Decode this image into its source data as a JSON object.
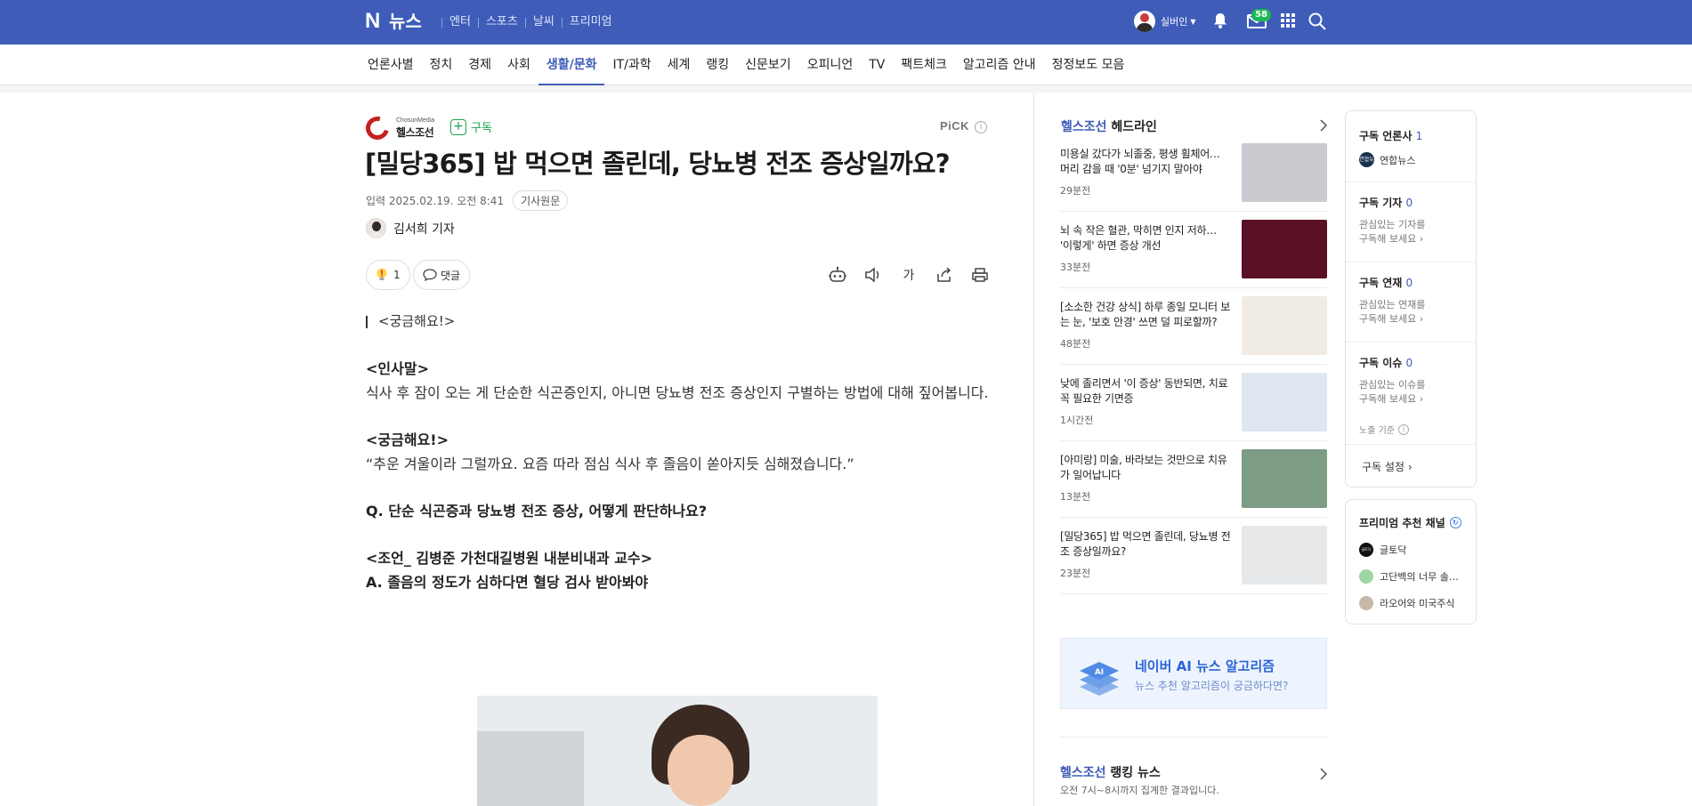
{
  "topbar": {
    "logo_letter": "N",
    "logo_text": "뉴스",
    "nav": [
      "엔터",
      "스포츠",
      "날씨",
      "프리미엄"
    ],
    "user_name": "실버인",
    "mail_count": "58"
  },
  "categories": [
    "언론사별",
    "정치",
    "경제",
    "사회",
    "생활/문화",
    "IT/과학",
    "세계",
    "랭킹",
    "신문보기",
    "오피니언",
    "TV",
    "팩트체크",
    "알고리즘 안내",
    "정정보도 모음"
  ],
  "active_category": "생활/문화",
  "article": {
    "press_small": "ChosunMedia",
    "press_name": "헬스조선",
    "subscribe_label": "구독",
    "pick_label": "PiCK",
    "pick_info": "i",
    "title": "[밀당365] 밥 먹으면 졸린데, 당뇨병 전조 증상일까요?",
    "date": "입력 2025.02.19. 오전 8:41",
    "original_label": "기사원문",
    "reporter": "김서희 기자",
    "reaction_count": "1",
    "comment_label": "댓글",
    "font_size_label": "가",
    "body": {
      "quote_head": "<궁금해요!>",
      "greeting_head": "<인사말>",
      "greeting_text": "식사 후 잠이 오는 게 단순한 식곤증인지, 아니면 당뇨병 전조 증상인지 구별하는 방법에 대해 짚어봅니다.",
      "question_head": "<궁금해요!>",
      "question_text": "“추운 겨울이라 그럴까요. 요즘 따라 점심 식사 후 졸음이 쏟아지듯 심해졌습니다.”",
      "q_line": "Q. 단순 식곤증과 당뇨병 전조 증상, 어떻게 판단하나요?",
      "advice_head": "<조언_ 김병준 가천대길병원 내분비내과 교수>",
      "a_line": "A. 졸음의 정도가 심하다면 혈당 검사 받아봐야"
    }
  },
  "headline": {
    "brand": "헬스조선",
    "label": "헤드라인",
    "items": [
      {
        "title": "미용실 갔다가 뇌졸중, 평생 휠체어… 머리 감을 때 '0분' 넘기지 말아야",
        "time": "29분전",
        "color": "#c9cbd0"
      },
      {
        "title": "뇌 속 작은 혈관, 막히면 인지 저하… '이렇게' 하면 증상 개선",
        "time": "33분전",
        "color": "#5a1024"
      },
      {
        "title": "[소소한 건강 상식] 하루 종일 모니터 보는 눈, '보호 안경' 쓰면 덜 피로할까?",
        "time": "48분전",
        "color": "#f0ece4"
      },
      {
        "title": "낮에 졸리면서 '이 증상' 동반되면, 치료 꼭 필요한 기면증",
        "time": "1시간전",
        "color": "#dfe6f1"
      },
      {
        "title": "[아미랑] 미술, 바라보는 것만으로 치유가 일어납니다",
        "time": "13분전",
        "color": "#7d9c86"
      },
      {
        "title": "[밀당365] 밥 먹으면 졸린데, 당뇨병 전조 증상일까요?",
        "time": "23분전",
        "color": "#e6e8ea"
      }
    ]
  },
  "ai_banner": {
    "title": "네이버 AI 뉴스 알고리즘",
    "subtitle": "뉴스 추천 알고리즘이 궁금하다면?",
    "icon_text": "AI"
  },
  "ranking": {
    "brand": "헬스조선",
    "label": "랭킹 뉴스",
    "subtitle": "오전 7시~8시까지 집계한 결과입니다."
  },
  "subscriptions": {
    "press": {
      "label": "구독 언론사",
      "count": "1",
      "item": "연합뉴스",
      "item_logo": "연합뉴스"
    },
    "reporter": {
      "label": "구독 기자",
      "count": "0",
      "desc1": "관심있는 기자를",
      "desc2": "구독해 보세요"
    },
    "series": {
      "label": "구독 연재",
      "count": "0",
      "desc1": "관심있는 연재를",
      "desc2": "구독해 보세요"
    },
    "issue": {
      "label": "구독 이슈",
      "count": "0",
      "desc1": "관심있는 이슈를",
      "desc2": "구독해 보세요"
    },
    "expose_label": "노출 기준",
    "expose_info": "i",
    "settings_label": "구독 설정"
  },
  "premium": {
    "title": "프리미엄 추천 채널",
    "refresh_icon": "↻",
    "channels": [
      {
        "name": "글토닥",
        "logo_text": "글토닥",
        "color": "#111111"
      },
      {
        "name": "고단백의 너무 솔직한 리뷰",
        "color": "#9fd4a3"
      },
      {
        "name": "라오어와 미국주식",
        "color": "#c8b8a8"
      }
    ]
  }
}
